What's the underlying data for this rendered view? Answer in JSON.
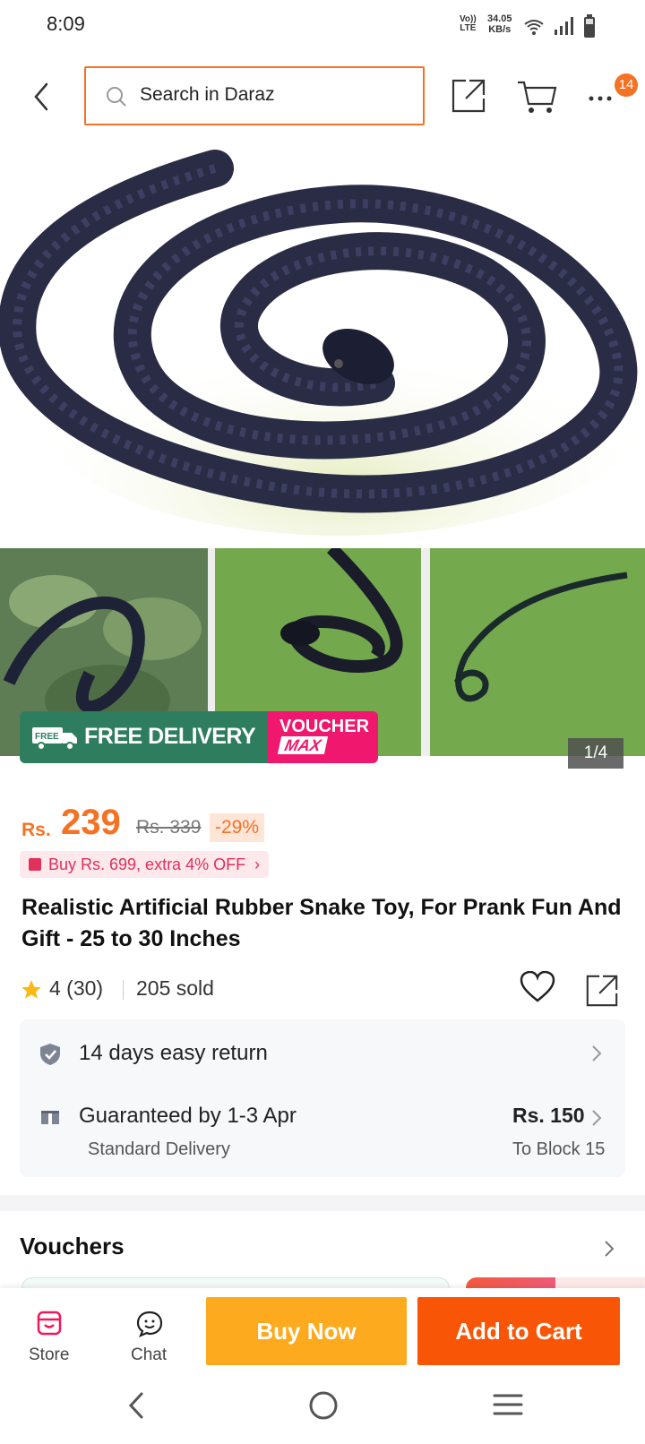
{
  "status_bar": {
    "time": "8:09",
    "network_top": "Vo))",
    "network_bottom": "LTE",
    "speed_value": "34.05",
    "speed_unit": "KB/s"
  },
  "header": {
    "search_placeholder": "Search in Daraz",
    "cart_badge": "14"
  },
  "gallery": {
    "counter": "1/4",
    "promo_free_delivery": "FREE DELIVERY",
    "promo_truck_label": "FREE",
    "promo_voucher_top": "VOUCHER",
    "promo_voucher_bottom": "MAX"
  },
  "product": {
    "currency": "Rs.",
    "price": "239",
    "old_price": "Rs. 339",
    "discount": "-29%",
    "deal": "Buy Rs. 699, extra 4% OFF",
    "title": "Realistic Artificial Rubber Snake Toy, For Prank Fun And Gift - 25 to 30 Inches",
    "rating": "4 (30)",
    "sold": "205 sold"
  },
  "delivery": {
    "return_text": "14 days easy return",
    "guarantee_text": "Guaranteed by 1-3 Apr",
    "method": "Standard Delivery",
    "fee": "Rs. 150",
    "destination": "To Block 15"
  },
  "vouchers": {
    "title": "Vouchers"
  },
  "actions": {
    "store_label": "Store",
    "chat_label": "Chat",
    "buy_now": "Buy Now",
    "add_to_cart": "Add to Cart"
  },
  "colors": {
    "accent": "#f57224",
    "buy_now": "#fdaa1e",
    "add_to_cart": "#f85606",
    "free_delivery": "#2e7d5e",
    "voucher_max": "#f0186e"
  }
}
